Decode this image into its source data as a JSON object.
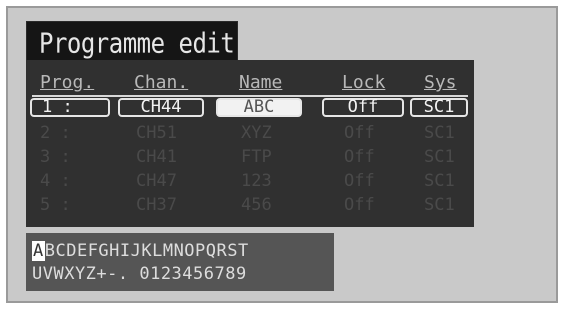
{
  "title": "Programme edit",
  "headers": {
    "prog": "Prog.",
    "chan": "Chan.",
    "name": "Name",
    "lock": "Lock",
    "sys": "Sys"
  },
  "rows": [
    {
      "prog": "1 :",
      "chan": "CH44",
      "name": "ABC",
      "lock": "Off",
      "sys": "SC1"
    },
    {
      "prog": "2 :",
      "chan": "CH51",
      "name": "XYZ",
      "lock": "Off",
      "sys": "SC1"
    },
    {
      "prog": "3 :",
      "chan": "CH41",
      "name": "FTP",
      "lock": "Off",
      "sys": "SC1"
    },
    {
      "prog": "4 :",
      "chan": "CH47",
      "name": "123",
      "lock": "Off",
      "sys": "SC1"
    },
    {
      "prog": "5 :",
      "chan": "CH37",
      "name": "456",
      "lock": "Off",
      "sys": "SC1"
    }
  ],
  "charset": {
    "cursor": "A",
    "line1_rest": "BCDEFGHIJKLMNOPQRST",
    "line2": "UVWXYZ+-. 0123456789"
  }
}
